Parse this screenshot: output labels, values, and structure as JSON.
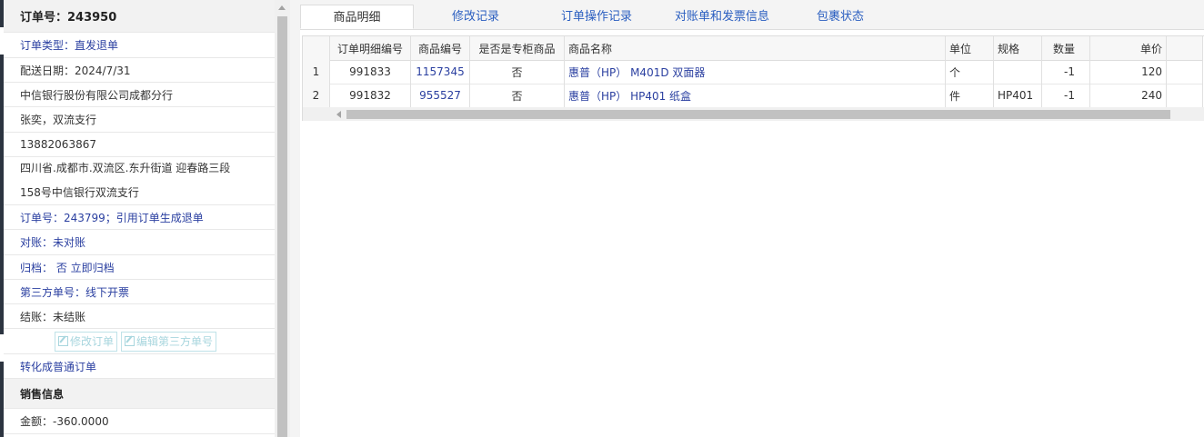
{
  "order_panel": {
    "order_number": "订单号：243950",
    "order_type": "订单类型：直发退单",
    "delivery_date": "配送日期：2024/7/31",
    "customer_company": "中信银行股份有限公司成都分行",
    "contact": "张奕，双流支行",
    "phone": "13882063867",
    "address_line1": "四川省.成都市.双流区.东升街道 迎春路三段",
    "address_line2": "158号中信银行双流支行",
    "source_order": "订单号：243799；引用订单生成退单",
    "reconcile": "对账：未对账",
    "archive": "归档：  否 立即归档",
    "third_party": "第三方单号：线下开票",
    "settlement": "结账：未结账",
    "edit_order_button": "修改订单",
    "edit_third_party_button": "编辑第三方单号",
    "convert_link": "转化成普通订单",
    "sales_header": "销售信息",
    "amount": "金额：-360.0000"
  },
  "tabs": [
    "商品明细",
    "修改记录",
    "订单操作记录",
    "对账单和发票信息",
    "包裹状态"
  ],
  "active_tab": 0,
  "grid": {
    "columns": [
      "订单明细编号",
      "商品编号",
      "是否是专柜商品",
      "商品名称",
      "单位",
      "规格",
      "数量",
      "单价"
    ],
    "rows": [
      {
        "idx": "1",
        "detail_no": "991833",
        "product_no": "1157345",
        "counter": "否",
        "name": "惠普（HP） M401D 双面器",
        "unit": "个",
        "spec": "",
        "qty": "-1",
        "price": "120"
      },
      {
        "idx": "2",
        "detail_no": "991832",
        "product_no": "955527",
        "counter": "否",
        "name": "惠普（HP） HP401 纸盒",
        "unit": "件",
        "spec": "HP401",
        "qty": "-1",
        "price": "240"
      }
    ]
  }
}
